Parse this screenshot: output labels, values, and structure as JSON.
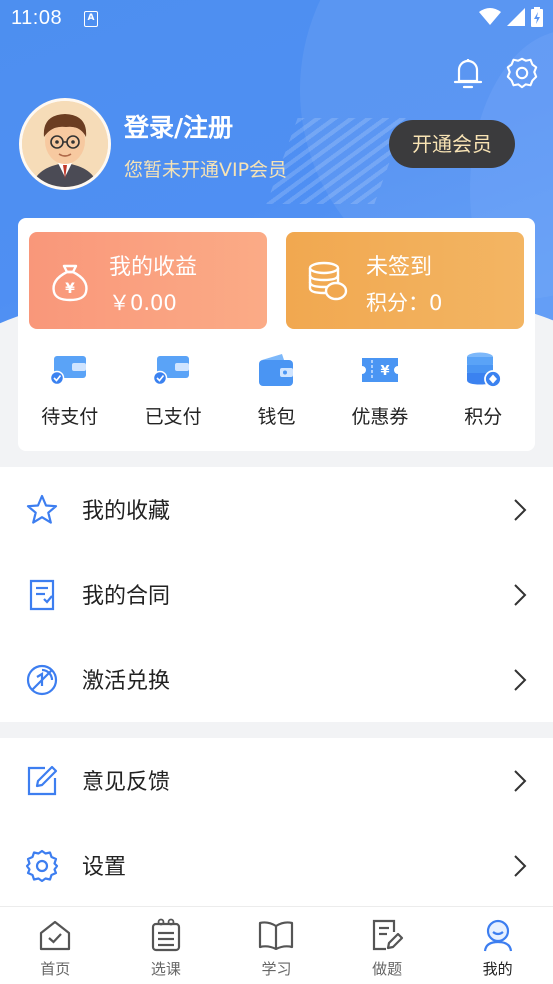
{
  "status_bar": {
    "time": "11:08",
    "notification_icon": "A"
  },
  "header": {
    "login_title": "登录/注册",
    "vip_status": "您暂未开通VIP会员",
    "vip_button": "开通会员"
  },
  "summary": {
    "earnings_label": "我的收益",
    "earnings_value": "￥0.00",
    "sign_label": "未签到",
    "points_text": "积分：0"
  },
  "quick_actions": [
    {
      "label": "待支付",
      "icon": "wallet-check-icon"
    },
    {
      "label": "已支付",
      "icon": "wallet-check-icon"
    },
    {
      "label": "钱包",
      "icon": "wallet-icon"
    },
    {
      "label": "优惠券",
      "icon": "coupon-icon"
    },
    {
      "label": "积分",
      "icon": "points-stack-icon"
    }
  ],
  "menu_group_1": [
    {
      "label": "我的收藏",
      "icon": "star-icon"
    },
    {
      "label": "我的合同",
      "icon": "contract-icon"
    },
    {
      "label": "激活兑换",
      "icon": "activate-icon"
    }
  ],
  "menu_group_2": [
    {
      "label": "意见反馈",
      "icon": "edit-feedback-icon"
    },
    {
      "label": "设置",
      "icon": "gear-icon"
    }
  ],
  "tabs": [
    {
      "label": "首页",
      "icon": "home-icon"
    },
    {
      "label": "选课",
      "icon": "calendar-icon"
    },
    {
      "label": "学习",
      "icon": "book-icon"
    },
    {
      "label": "做题",
      "icon": "exercise-icon"
    },
    {
      "label": "我的",
      "icon": "profile-icon",
      "active": true
    }
  ],
  "colors": {
    "header_blue": "#4f8ff3",
    "earnings_tile": "#f9977a",
    "sign_tile": "#f1a850",
    "icon_blue": "#3d7ef0",
    "vip_text": "#f8e3b4"
  }
}
